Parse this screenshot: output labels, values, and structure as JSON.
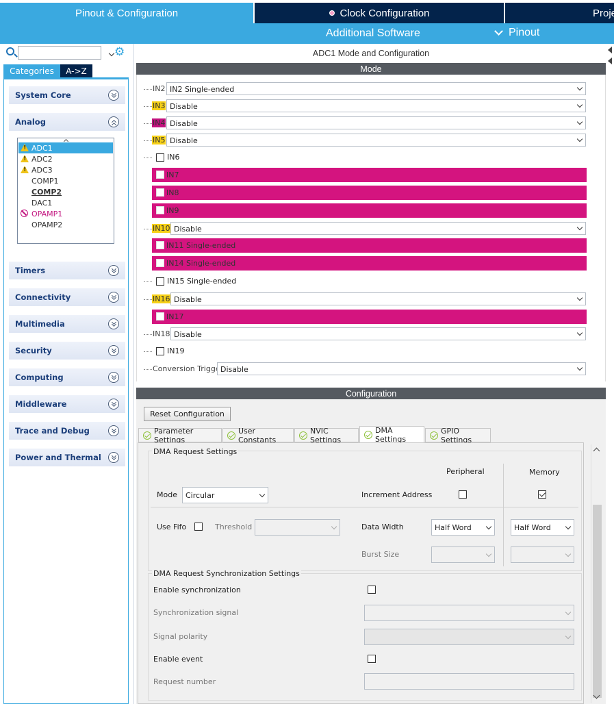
{
  "header": {
    "tab_pinout": "Pinout & Configuration",
    "tab_clock": "Clock Configuration",
    "tab_project": "Proje",
    "sub_additional": "Additional Software",
    "sub_pinout": "Pinout"
  },
  "sidebar": {
    "search_value": "",
    "tab_categories": "Categories",
    "tab_az": "A->Z",
    "categories": {
      "system_core": "System Core",
      "analog": "Analog",
      "timers": "Timers",
      "connectivity": "Connectivity",
      "multimedia": "Multimedia",
      "security": "Security",
      "computing": "Computing",
      "middleware": "Middleware",
      "trace": "Trace and Debug",
      "power": "Power and Thermal"
    },
    "analog_items": {
      "adc1": "ADC1",
      "adc2": "ADC2",
      "adc3": "ADC3",
      "comp1": "COMP1",
      "comp2": "COMP2",
      "dac1": "DAC1",
      "opamp1": "OPAMP1",
      "opamp2": "OPAMP2"
    }
  },
  "mode": {
    "title": "ADC1 Mode and Configuration",
    "bar": "Mode",
    "in2": {
      "label": "IN2",
      "value": "IN2 Single-ended"
    },
    "in3": {
      "label": "IN3",
      "value": "Disable"
    },
    "in4": {
      "label": "IN4",
      "value": "Disable"
    },
    "in5": {
      "label": "IN5",
      "value": "Disable"
    },
    "in6": "IN6",
    "in7": "IN7",
    "in8": "IN8",
    "in9": "IN9",
    "in10": {
      "label": "IN10",
      "value": "Disable"
    },
    "in11": "IN11 Single-ended",
    "in14": "IN14 Single-ended",
    "in15": "IN15 Single-ended",
    "in16": {
      "label": "IN16",
      "value": "Disable"
    },
    "in17": "IN17",
    "in18": {
      "label": "IN18",
      "value": "Disable"
    },
    "in19": "IN19",
    "conv_trigger": {
      "label": "Conversion Trigger",
      "value": "Disable"
    }
  },
  "config": {
    "bar": "Configuration",
    "reset": "Reset Configuration",
    "tabs": {
      "param": "Parameter Settings",
      "user": "User Constants",
      "nvic": "NVIC Settings",
      "dma": "DMA Settings",
      "gpio": "GPIO Settings"
    },
    "dma": {
      "req_title": "DMA Request Settings",
      "peripheral": "Peripheral",
      "memory": "Memory",
      "mode_label": "Mode",
      "mode_value": "Circular",
      "increment": "Increment Address",
      "use_fifo": "Use Fifo",
      "threshold": "Threshold",
      "data_width": "Data Width",
      "periph_width": "Half Word",
      "mem_width": "Half Word",
      "burst": "Burst Size",
      "sync_title": "DMA Request Synchronization Settings",
      "enable_sync": "Enable synchronization",
      "sync_signal": "Synchronization signal",
      "signal_polarity": "Signal polarity",
      "enable_event": "Enable event",
      "request_number": "Request number"
    }
  },
  "colors": {
    "accent_blue": "#3aa9e0",
    "navy": "#03234b",
    "warning_yellow": "#f7d117",
    "error_magenta": "#d4147f"
  }
}
